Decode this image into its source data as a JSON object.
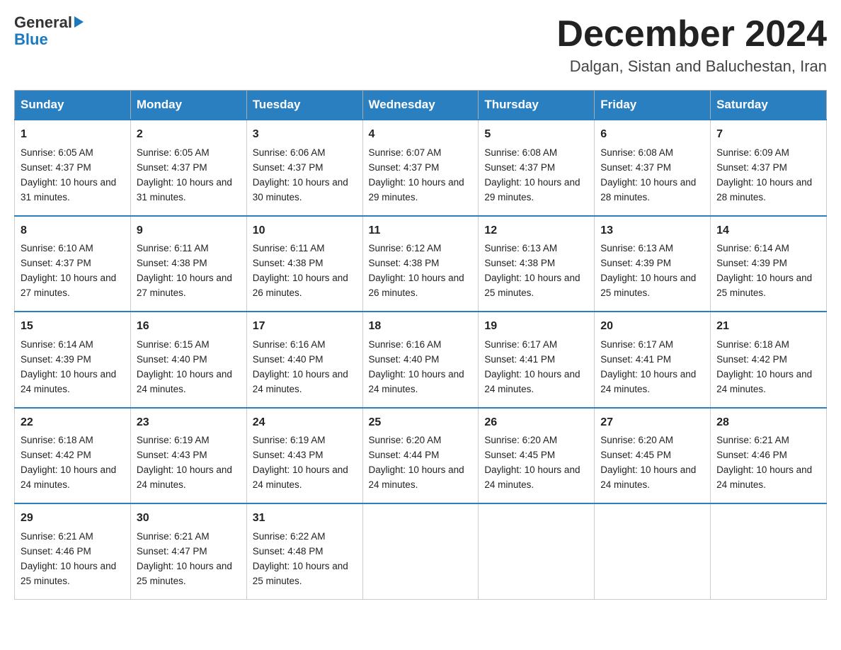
{
  "header": {
    "logo": {
      "general": "General",
      "blue": "Blue"
    },
    "title": "December 2024",
    "location": "Dalgan, Sistan and Baluchestan, Iran"
  },
  "days_of_week": [
    "Sunday",
    "Monday",
    "Tuesday",
    "Wednesday",
    "Thursday",
    "Friday",
    "Saturday"
  ],
  "weeks": [
    [
      {
        "day": "1",
        "sunrise": "6:05 AM",
        "sunset": "4:37 PM",
        "daylight": "10 hours and 31 minutes."
      },
      {
        "day": "2",
        "sunrise": "6:05 AM",
        "sunset": "4:37 PM",
        "daylight": "10 hours and 31 minutes."
      },
      {
        "day": "3",
        "sunrise": "6:06 AM",
        "sunset": "4:37 PM",
        "daylight": "10 hours and 30 minutes."
      },
      {
        "day": "4",
        "sunrise": "6:07 AM",
        "sunset": "4:37 PM",
        "daylight": "10 hours and 29 minutes."
      },
      {
        "day": "5",
        "sunrise": "6:08 AM",
        "sunset": "4:37 PM",
        "daylight": "10 hours and 29 minutes."
      },
      {
        "day": "6",
        "sunrise": "6:08 AM",
        "sunset": "4:37 PM",
        "daylight": "10 hours and 28 minutes."
      },
      {
        "day": "7",
        "sunrise": "6:09 AM",
        "sunset": "4:37 PM",
        "daylight": "10 hours and 28 minutes."
      }
    ],
    [
      {
        "day": "8",
        "sunrise": "6:10 AM",
        "sunset": "4:37 PM",
        "daylight": "10 hours and 27 minutes."
      },
      {
        "day": "9",
        "sunrise": "6:11 AM",
        "sunset": "4:38 PM",
        "daylight": "10 hours and 27 minutes."
      },
      {
        "day": "10",
        "sunrise": "6:11 AM",
        "sunset": "4:38 PM",
        "daylight": "10 hours and 26 minutes."
      },
      {
        "day": "11",
        "sunrise": "6:12 AM",
        "sunset": "4:38 PM",
        "daylight": "10 hours and 26 minutes."
      },
      {
        "day": "12",
        "sunrise": "6:13 AM",
        "sunset": "4:38 PM",
        "daylight": "10 hours and 25 minutes."
      },
      {
        "day": "13",
        "sunrise": "6:13 AM",
        "sunset": "4:39 PM",
        "daylight": "10 hours and 25 minutes."
      },
      {
        "day": "14",
        "sunrise": "6:14 AM",
        "sunset": "4:39 PM",
        "daylight": "10 hours and 25 minutes."
      }
    ],
    [
      {
        "day": "15",
        "sunrise": "6:14 AM",
        "sunset": "4:39 PM",
        "daylight": "10 hours and 24 minutes."
      },
      {
        "day": "16",
        "sunrise": "6:15 AM",
        "sunset": "4:40 PM",
        "daylight": "10 hours and 24 minutes."
      },
      {
        "day": "17",
        "sunrise": "6:16 AM",
        "sunset": "4:40 PM",
        "daylight": "10 hours and 24 minutes."
      },
      {
        "day": "18",
        "sunrise": "6:16 AM",
        "sunset": "4:40 PM",
        "daylight": "10 hours and 24 minutes."
      },
      {
        "day": "19",
        "sunrise": "6:17 AM",
        "sunset": "4:41 PM",
        "daylight": "10 hours and 24 minutes."
      },
      {
        "day": "20",
        "sunrise": "6:17 AM",
        "sunset": "4:41 PM",
        "daylight": "10 hours and 24 minutes."
      },
      {
        "day": "21",
        "sunrise": "6:18 AM",
        "sunset": "4:42 PM",
        "daylight": "10 hours and 24 minutes."
      }
    ],
    [
      {
        "day": "22",
        "sunrise": "6:18 AM",
        "sunset": "4:42 PM",
        "daylight": "10 hours and 24 minutes."
      },
      {
        "day": "23",
        "sunrise": "6:19 AM",
        "sunset": "4:43 PM",
        "daylight": "10 hours and 24 minutes."
      },
      {
        "day": "24",
        "sunrise": "6:19 AM",
        "sunset": "4:43 PM",
        "daylight": "10 hours and 24 minutes."
      },
      {
        "day": "25",
        "sunrise": "6:20 AM",
        "sunset": "4:44 PM",
        "daylight": "10 hours and 24 minutes."
      },
      {
        "day": "26",
        "sunrise": "6:20 AM",
        "sunset": "4:45 PM",
        "daylight": "10 hours and 24 minutes."
      },
      {
        "day": "27",
        "sunrise": "6:20 AM",
        "sunset": "4:45 PM",
        "daylight": "10 hours and 24 minutes."
      },
      {
        "day": "28",
        "sunrise": "6:21 AM",
        "sunset": "4:46 PM",
        "daylight": "10 hours and 24 minutes."
      }
    ],
    [
      {
        "day": "29",
        "sunrise": "6:21 AM",
        "sunset": "4:46 PM",
        "daylight": "10 hours and 25 minutes."
      },
      {
        "day": "30",
        "sunrise": "6:21 AM",
        "sunset": "4:47 PM",
        "daylight": "10 hours and 25 minutes."
      },
      {
        "day": "31",
        "sunrise": "6:22 AM",
        "sunset": "4:48 PM",
        "daylight": "10 hours and 25 minutes."
      },
      null,
      null,
      null,
      null
    ]
  ],
  "labels": {
    "sunrise_prefix": "Sunrise: ",
    "sunset_prefix": "Sunset: ",
    "daylight_prefix": "Daylight: "
  }
}
